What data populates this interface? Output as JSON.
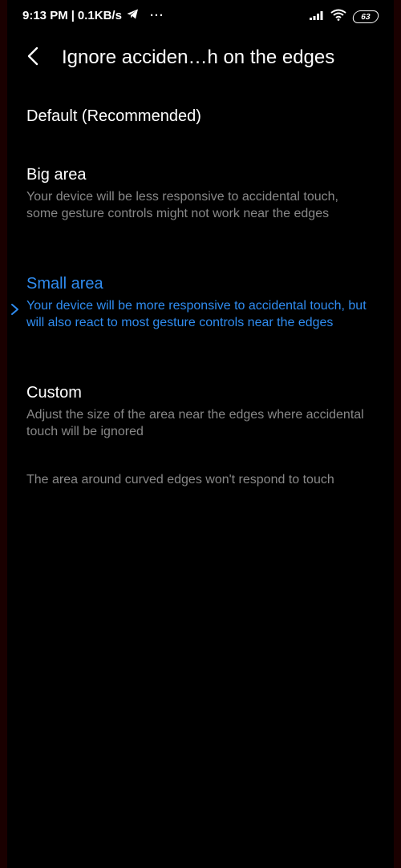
{
  "status_bar": {
    "time": "9:13 PM",
    "separator": "|",
    "network_speed": "0.1KB/s",
    "more": "···",
    "battery_level": "63"
  },
  "header": {
    "title": "Ignore acciden…h on the edges"
  },
  "options": [
    {
      "title": "Default (Recommended)",
      "description": ""
    },
    {
      "title": "Big area",
      "description": "Your device will be less responsive to accidental touch, some gesture controls might not work near the edges"
    },
    {
      "title": "Small area",
      "description": "Your device will be more responsive to accidental touch, but will also react to most gesture controls near the edges"
    },
    {
      "title": "Custom",
      "description": "Adjust the size of the area near the edges where accidental touch will be ignored"
    }
  ],
  "selected_option": "Small area",
  "footer_note": "The area around curved edges won't respond to touch",
  "colors": {
    "background": "#000000",
    "accent": "#2f8cf0",
    "secondary_text": "#888888",
    "edge": "#1a0000"
  }
}
